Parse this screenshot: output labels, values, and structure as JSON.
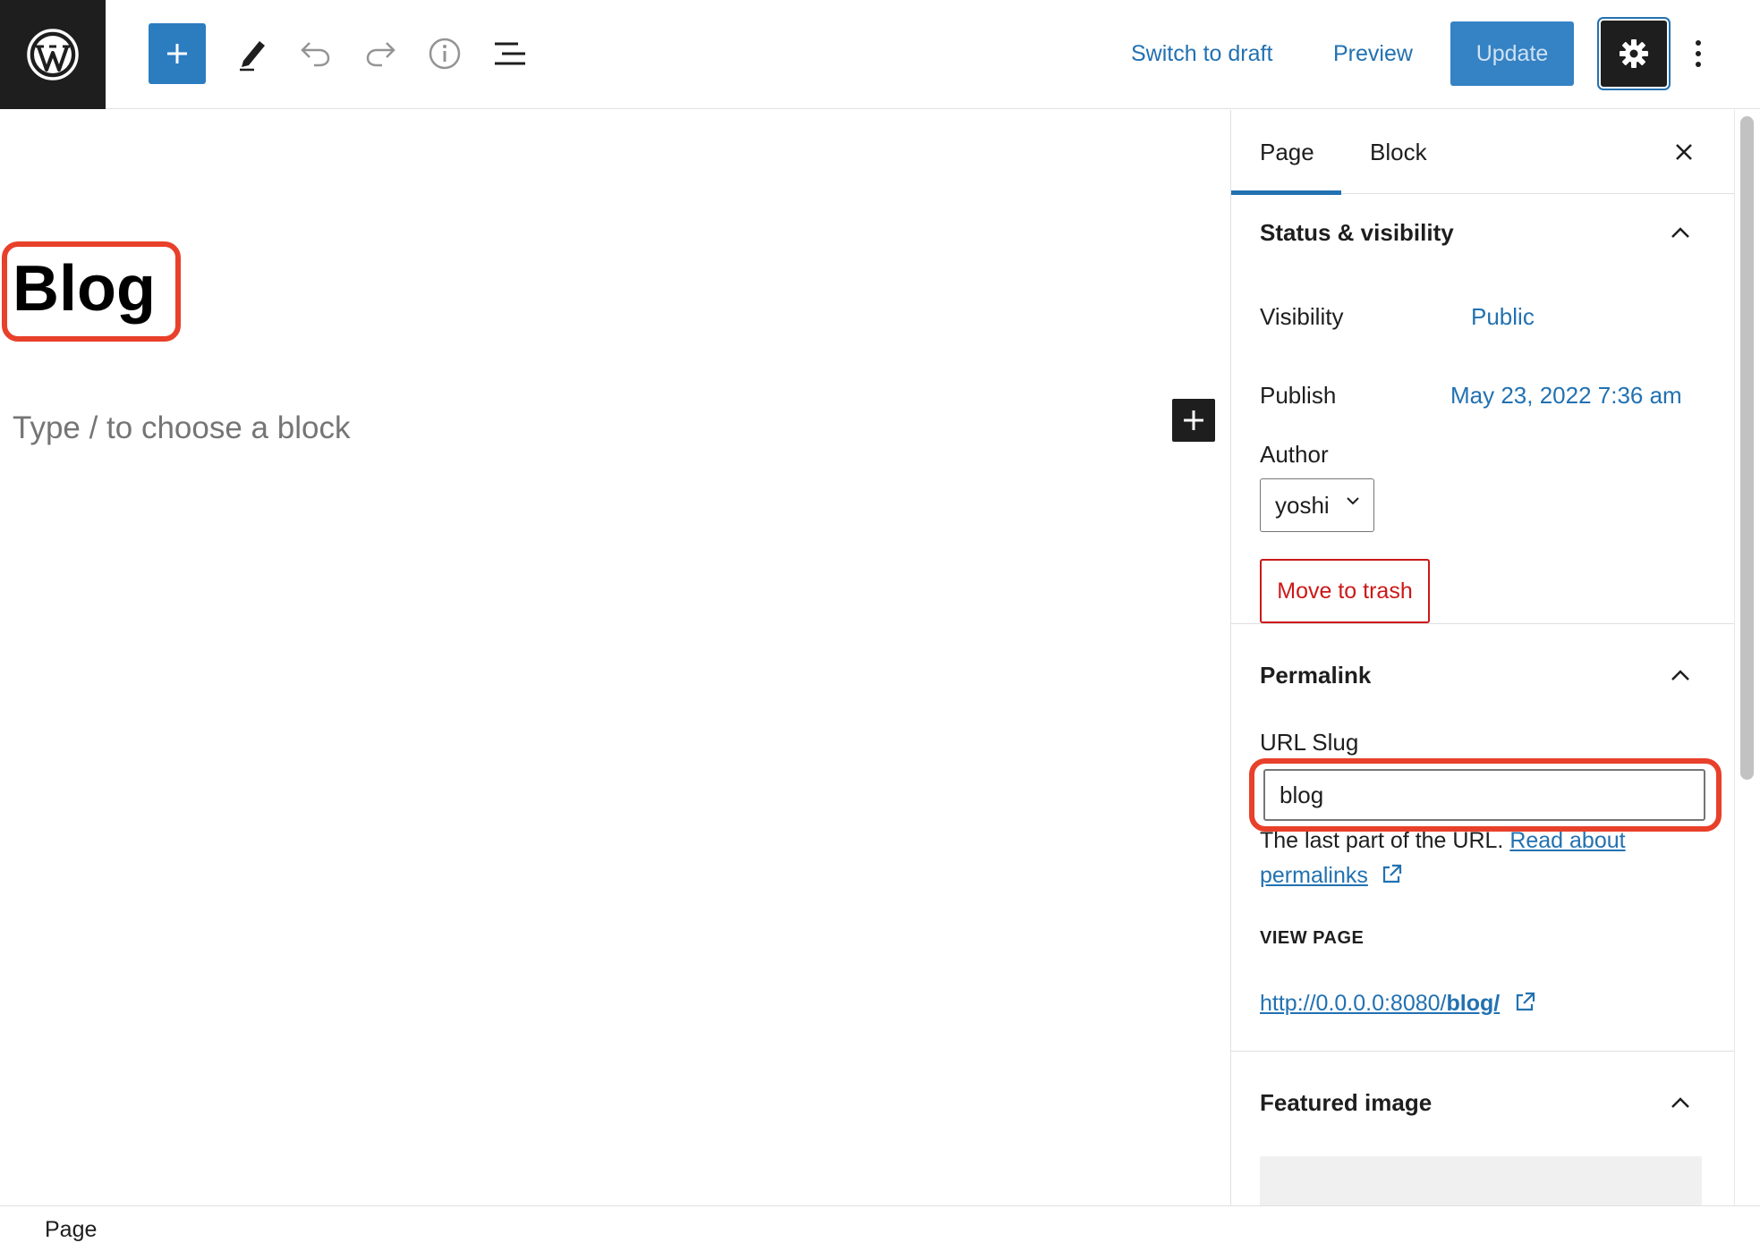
{
  "toolbar": {
    "switch_to_draft": "Switch to draft",
    "preview": "Preview",
    "update": "Update"
  },
  "editor": {
    "title": "Blog",
    "placeholder": "Type / to choose a block"
  },
  "sidebar": {
    "tabs": [
      "Page",
      "Block"
    ],
    "status": {
      "heading": "Status & visibility",
      "visibility_label": "Visibility",
      "visibility_value": "Public",
      "publish_label": "Publish",
      "publish_value": "May 23, 2022 7:36 am",
      "author_label": "Author",
      "author_value": "yoshi",
      "trash": "Move to trash"
    },
    "permalink": {
      "heading": "Permalink",
      "slug_label": "URL Slug",
      "slug_value": "blog",
      "help_prefix": "The last part of the URL.",
      "help_link_1": "Read about",
      "help_link_2": "permalinks",
      "view_label": "VIEW PAGE",
      "url_prefix": "http://0.0.0.0:8080/",
      "url_slug": "blog/"
    },
    "featured": {
      "heading": "Featured image"
    }
  },
  "footer": {
    "breadcrumb": "Page"
  },
  "colors": {
    "accent": "#2271b1",
    "highlight": "#e8402a",
    "danger": "#cc1818",
    "dark": "#1e1e1e"
  },
  "icons": [
    "wordpress-logo-icon",
    "plus-icon",
    "pencil-icon",
    "undo-icon",
    "redo-icon",
    "info-icon",
    "list-view-icon",
    "gear-icon",
    "more-vertical-icon",
    "close-icon",
    "chevron-up-icon",
    "chevron-down-icon",
    "external-link-icon"
  ]
}
